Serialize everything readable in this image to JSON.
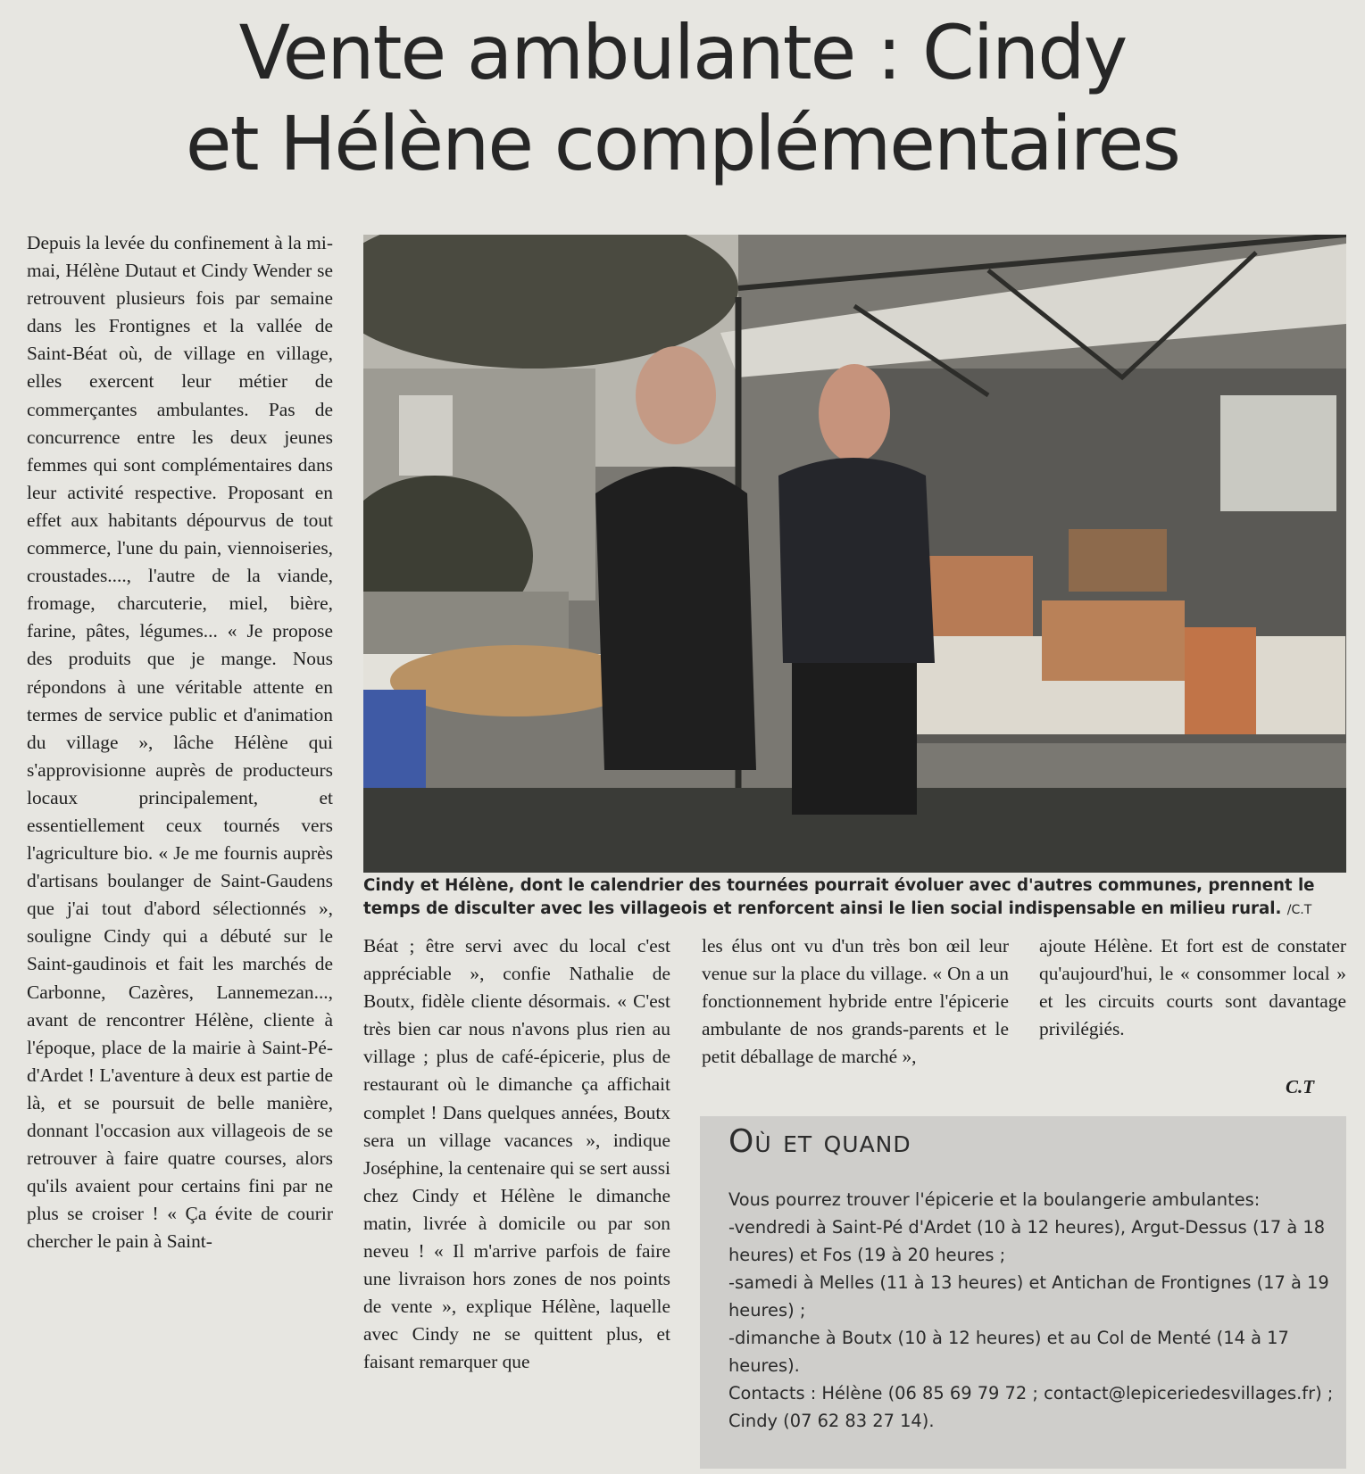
{
  "article": {
    "headline_line1": "Vente ambulante : Cindy",
    "headline_line2": "et Hélène complémentaires",
    "col1": "Depuis la levée du confinement à la mi-mai, Hélène Dutaut et Cindy Wender se retrouvent plusieurs fois par semaine dans les Frontignes et la vallée de Saint-Béat où, de village en village, elles exercent leur métier de commerçantes ambulantes. Pas de concurrence entre les deux jeunes femmes qui sont complémentaires dans leur activité respective. Proposant en effet aux habitants dépourvus de tout commerce, l'une du pain, viennoiseries, croustades...., l'autre de la viande, fromage, charcuterie, miel, bière, farine, pâtes, légumes... « Je propose des produits que je mange. Nous répondons à une véritable attente en termes de service public et d'animation du village », lâche Hélène qui s'approvisionne auprès de producteurs locaux principalement, et essentiellement ceux tournés vers l'agriculture bio. « Je me fournis auprès d'artisans boulanger de Saint-Gaudens que j'ai tout d'abord sélectionnés », souligne Cindy qui a débuté sur le Saint-gaudinois et fait les marchés de Carbonne, Cazères, Lannemezan..., avant de rencontrer Hélène, cliente à l'époque, place de la mairie à Saint-Pé-d'Ardet ! L'aventure à deux est partie de là, et se poursuit de belle manière, donnant l'occasion aux villageois de se retrouver à faire quatre courses, alors qu'ils avaient pour certains fini par ne plus se croiser ! « Ça évite de courir chercher le pain à Saint-",
    "col2": "Béat ; être servi avec du local c'est appréciable », confie Nathalie de Boutx, fidèle cliente désormais. « C'est très bien car nous n'avons plus rien au village ; plus de café-épicerie, plus de restaurant où le dimanche ça affichait complet ! Dans quelques années, Boutx sera un village vacances », indique Joséphine, la centenaire qui se sert aussi chez Cindy et Hélène le dimanche matin, livrée à domicile ou par son neveu ! « Il m'arrive parfois de faire une livraison hors zones de nos points de vente », explique Hélène, laquelle avec Cindy ne se quittent plus, et faisant remarquer que",
    "col3": "les élus ont vu d'un très bon œil leur venue sur la place du village. « On a un fonctionnement hybride entre l'épicerie ambulante de nos grands-parents et le petit déballage de marché »,",
    "col4": "ajoute Hélène. Et fort est de constater qu'aujourd'hui, le « consommer local » et les circuits courts sont davantage privilégiés.",
    "byline": "C.T"
  },
  "photo": {
    "caption": "Cindy et Hélène, dont le calendrier des tournées pourrait évoluer avec d'autres communes, prennent le temps de disculter avec les villageois et renforcent ainsi le lien social indispensable en milieu rural.",
    "credit": "/C.T"
  },
  "info_box": {
    "title": "Où et quand",
    "lines": [
      "Vous pourrez trouver l'épicerie et la boulangerie ambulantes:",
      "-vendredi à Saint-Pé d'Ardet (10 à 12 heures), Argut-Dessus (17 à 18 heures) et Fos (19 à 20 heures ;",
      "-samedi à Melles (11 à 13 heures) et Antichan de Frontignes (17 à 19 heures) ;",
      "-dimanche à Boutx (10 à 12 heures) et au Col de Menté (14 à 17 heures).",
      "Contacts : Hélène (06 85 69 79 72 ; contact@lepiceriedesvillages.fr) ; Cindy (07 62 83 27 14)."
    ]
  }
}
